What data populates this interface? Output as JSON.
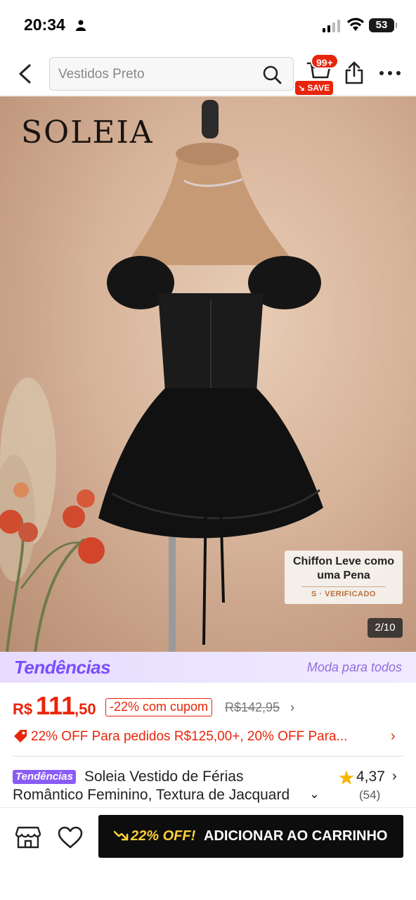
{
  "status_bar": {
    "time": "20:34",
    "battery": "53"
  },
  "nav": {
    "search_placeholder": "Vestidos Preto",
    "cart_badge": "99+",
    "save_badge": "SAVE"
  },
  "hero": {
    "brand": "SOLEIA",
    "card_title": "Chiffon Leve como uma Pena",
    "card_verified": "S · VERIFICADO",
    "image_counter": "2/10"
  },
  "trend_banner": {
    "logo": "Tendências",
    "tagline": "Moda para todos"
  },
  "price": {
    "currency": "R$",
    "integer": "111",
    "decimal": ",50",
    "coupon": "-22% com cupom",
    "original": "R$142,95",
    "color": "#e8250a"
  },
  "promo": {
    "text": "22% OFF Para pedidos R$125,00+,  20% OFF Para..."
  },
  "product": {
    "badge": "Tendências",
    "title_line1": "Soleia Vestido de Férias",
    "title_line2": "Romântico Feminino, Textura de Jacquard",
    "rating": "4,37",
    "reviews": "(54)"
  },
  "bottom_bar": {
    "discount": "22% OFF!",
    "add_to_cart": "ADICIONAR AO CARRINHO"
  }
}
